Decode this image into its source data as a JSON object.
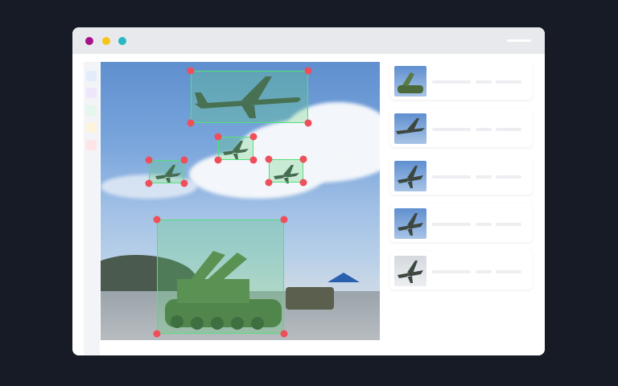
{
  "window": {
    "traffic_lights": [
      "#a8108a",
      "#f7c51a",
      "#2ab7c6"
    ],
    "sidebar_swatches": [
      "#e3ecfb",
      "#eee6fb",
      "#e5f6ec",
      "#fdf4dd",
      "#fde5e7"
    ]
  },
  "annotations": [
    {
      "label_icon": "aircraft-icon"
    },
    {
      "label_icon": "aircraft-icon"
    },
    {
      "label_icon": "aircraft-icon"
    },
    {
      "label_icon": "aircraft-icon"
    },
    {
      "label_icon": "tank-icon"
    }
  ],
  "results_panel": {
    "items": [
      {
        "thumb_icon": "tank-icon"
      },
      {
        "thumb_icon": "aircraft-icon"
      },
      {
        "thumb_icon": "aircraft-icon"
      },
      {
        "thumb_icon": "aircraft-icon"
      },
      {
        "thumb_icon": "aircraft-icon"
      }
    ]
  },
  "colors": {
    "bbox_stroke": "#52e07a",
    "handle": "#ef4f5b"
  }
}
